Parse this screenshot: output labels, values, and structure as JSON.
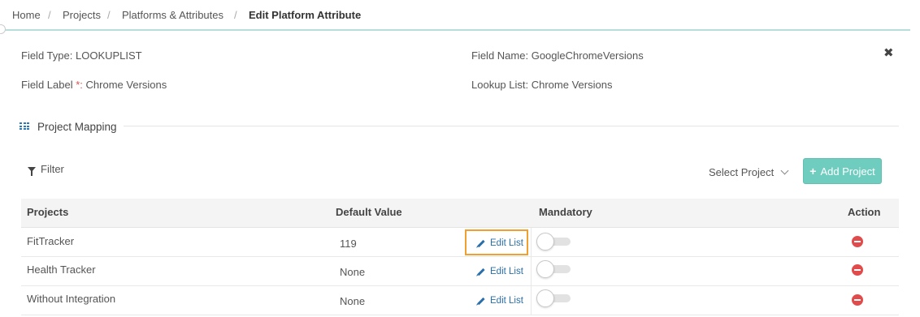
{
  "breadcrumb": {
    "items": [
      "Home",
      "Projects",
      "Platforms & Attributes"
    ],
    "active": "Edit Platform Attribute",
    "separator": "/"
  },
  "fields": {
    "field_type_label": "Field Type:",
    "field_type_value": "LOOKUPLIST",
    "field_name_label": "Field Name:",
    "field_name_value": "GoogleChromeVersions",
    "field_label_label": "Field Label",
    "field_label_required": "*:",
    "field_label_value": "Chrome Versions",
    "lookup_list_label": "Lookup List:",
    "lookup_list_value": "Chrome Versions"
  },
  "close_glyph": "✖",
  "section": {
    "title": "Project Mapping",
    "icon": "grid-icon"
  },
  "toolbar": {
    "filter_label": "Filter",
    "select_project_label": "Select Project",
    "add_project_label": "Add Project",
    "add_glyph": "+"
  },
  "table": {
    "headers": [
      "Projects",
      "Default Value",
      "Mandatory",
      "Action"
    ],
    "edit_list_label": "Edit List",
    "rows": [
      {
        "project": "FitTracker",
        "default_value": "119",
        "mandatory": false,
        "highlighted": true
      },
      {
        "project": "Health Tracker",
        "default_value": "None",
        "mandatory": false,
        "highlighted": false
      },
      {
        "project": "Without Integration",
        "default_value": "None",
        "mandatory": false,
        "highlighted": false
      }
    ]
  },
  "colors": {
    "accent": "#6fcdc0",
    "link": "#2a6fa8",
    "danger": "#e14b4b",
    "highlight": "#f0a030",
    "header_border": "#b6dedb"
  }
}
